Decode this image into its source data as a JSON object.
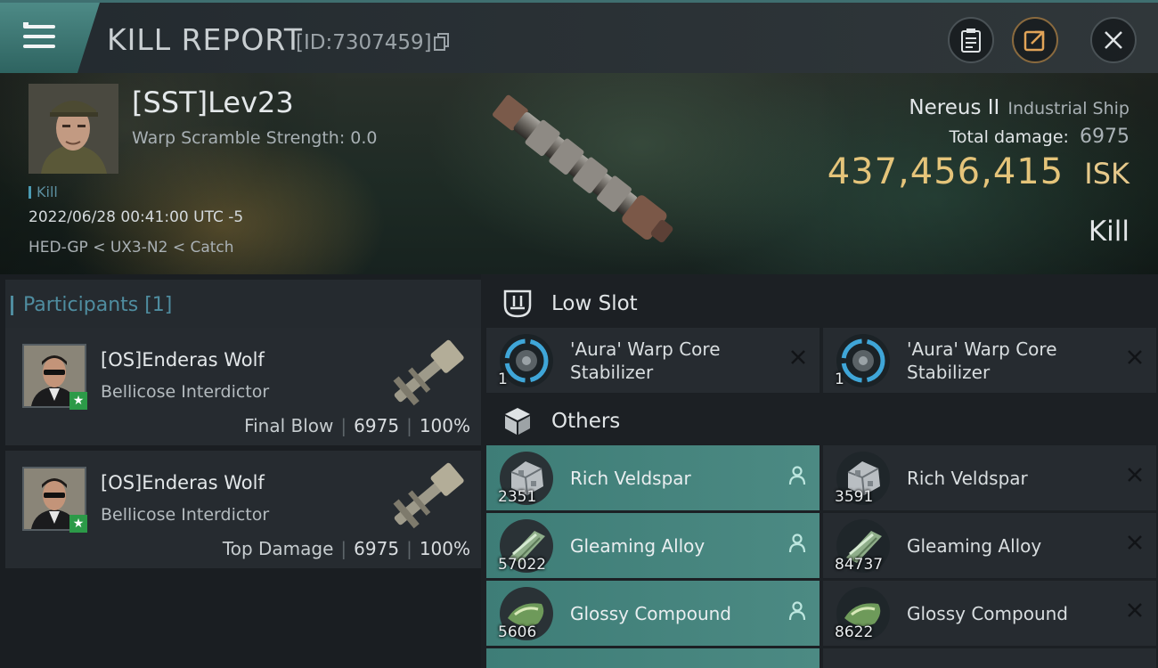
{
  "header": {
    "title": "KILL REPORT",
    "report_id": "[ID:7307459]",
    "icons": [
      "menu-icon",
      "copy-icon",
      "clipboard-icon",
      "share-icon",
      "close-icon"
    ]
  },
  "victim": {
    "name": "[SST]Lev23",
    "warp_scramble": "Warp Scramble Strength: 0.0",
    "kill_tag": "Kill",
    "datetime": "2022/06/28 00:41:00 UTC -5",
    "route": "HED-GP < UX3-N2 < Catch"
  },
  "ship": {
    "name": "Nereus II",
    "class": "Industrial Ship",
    "damage_label": "Total damage:",
    "damage_value": "6975",
    "isk_value": "437,456,415",
    "isk_unit": "ISK",
    "status": "Kill"
  },
  "participants": {
    "header": "Participants [1]",
    "cards": [
      {
        "name": "[OS]Enderas Wolf",
        "ship": "Bellicose Interdictor",
        "role": "Final Blow",
        "damage": "6975",
        "percent": "100%"
      },
      {
        "name": "[OS]Enderas Wolf",
        "ship": "Bellicose Interdictor",
        "role": "Top Damage",
        "damage": "6975",
        "percent": "100%"
      }
    ]
  },
  "sections": {
    "low_slot": "Low Slot",
    "others": "Others"
  },
  "low_slot_items": [
    {
      "qty": "1",
      "name_line1": "'Aura' Warp Core",
      "name_line2": "Stabilizer",
      "status": "destroyed"
    },
    {
      "qty": "1",
      "name_line1": "'Aura' Warp Core",
      "name_line2": "Stabilizer",
      "status": "destroyed"
    }
  ],
  "other_items": [
    {
      "qty": "2351",
      "name": "Rich Veldspar",
      "status": "dropped"
    },
    {
      "qty": "3591",
      "name": "Rich Veldspar",
      "status": "destroyed"
    },
    {
      "qty": "57022",
      "name": "Gleaming Alloy",
      "status": "dropped"
    },
    {
      "qty": "84737",
      "name": "Gleaming Alloy",
      "status": "destroyed"
    },
    {
      "qty": "5606",
      "name": "Glossy Compound",
      "status": "dropped"
    },
    {
      "qty": "8622",
      "name": "Glossy Compound",
      "status": "destroyed"
    }
  ],
  "colors": {
    "accent": "#4f8da0",
    "isk": "#e5c47a",
    "dropped_bg": "#4c8a83",
    "destroyed_bg": "#262b30"
  }
}
